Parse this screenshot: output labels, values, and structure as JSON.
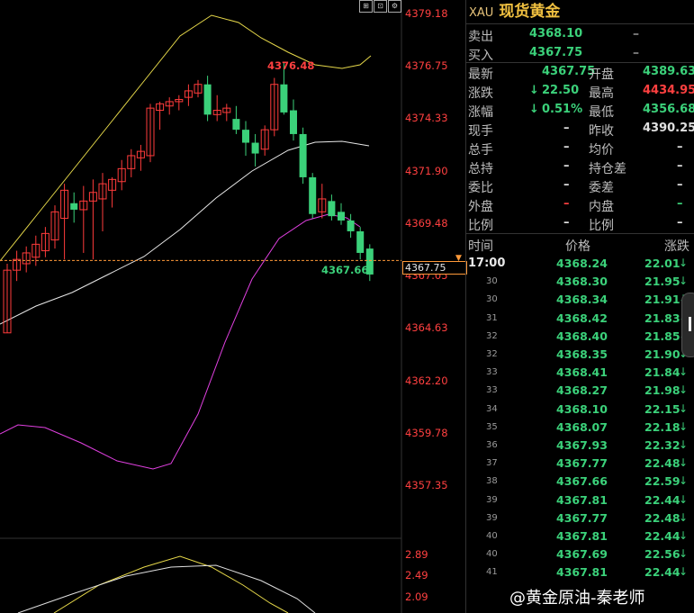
{
  "toolbar": {
    "icons": [
      "zoom-fit-icon",
      "chart-type-icon",
      "settings-icon"
    ]
  },
  "header": {
    "code": "XAU",
    "name": "现货黄金"
  },
  "quote": {
    "sell_label": "卖出",
    "sell_value": "4368.10",
    "sell_extra": "–",
    "buy_label": "买入",
    "buy_value": "4367.75",
    "buy_extra": "–",
    "rows": [
      {
        "l1": "最新",
        "v1": "4367.75",
        "l2": "开盘",
        "v2": "4389.63",
        "c1": "green",
        "c2": "green"
      },
      {
        "l1": "涨跌",
        "v1": "22.50",
        "a1": "↓",
        "l2": "最高",
        "v2": "4434.95",
        "c1": "green",
        "c2": "red"
      },
      {
        "l1": "涨幅",
        "v1": "0.51%",
        "a1": "↓",
        "l2": "最低",
        "v2": "4356.68",
        "c1": "green",
        "c2": "green"
      },
      {
        "l1": "现手",
        "v1": "–",
        "l2": "昨收",
        "v2": "4390.25",
        "c1": "white",
        "c2": "white"
      },
      {
        "l1": "总手",
        "v1": "–",
        "l2": "均价",
        "v2": "–",
        "c1": "white",
        "c2": "white"
      },
      {
        "l1": "总持",
        "v1": "–",
        "l2": "持仓差",
        "v2": "–",
        "c1": "white",
        "c2": "white"
      },
      {
        "l1": "委比",
        "v1": "–",
        "l2": "委差",
        "v2": "–",
        "c1": "white",
        "c2": "white"
      },
      {
        "l1": "外盘",
        "v1": "–",
        "l2": "内盘",
        "v2": "–",
        "c1": "red",
        "c2": "green"
      },
      {
        "l1": "比例",
        "v1": "–",
        "l2": "比例",
        "v2": "–",
        "c1": "white",
        "c2": "white"
      }
    ]
  },
  "ticks_header": {
    "time": "时间",
    "price": "价格",
    "change": "涨跌"
  },
  "ticks": [
    {
      "t": "17:00",
      "p": "4368.24",
      "c": "22.01"
    },
    {
      "t": "30",
      "p": "4368.30",
      "c": "21.95"
    },
    {
      "t": "30",
      "p": "4368.34",
      "c": "21.91"
    },
    {
      "t": "31",
      "p": "4368.42",
      "c": "21.83"
    },
    {
      "t": "32",
      "p": "4368.40",
      "c": "21.85"
    },
    {
      "t": "32",
      "p": "4368.35",
      "c": "21.90"
    },
    {
      "t": "33",
      "p": "4368.41",
      "c": "21.84"
    },
    {
      "t": "33",
      "p": "4368.27",
      "c": "21.98"
    },
    {
      "t": "34",
      "p": "4368.10",
      "c": "22.15"
    },
    {
      "t": "35",
      "p": "4368.07",
      "c": "22.18"
    },
    {
      "t": "36",
      "p": "4367.93",
      "c": "22.32"
    },
    {
      "t": "37",
      "p": "4367.77",
      "c": "22.48"
    },
    {
      "t": "38",
      "p": "4367.66",
      "c": "22.59"
    },
    {
      "t": "39",
      "p": "4367.81",
      "c": "22.44"
    },
    {
      "t": "39",
      "p": "4367.77",
      "c": "22.48"
    },
    {
      "t": "40",
      "p": "4367.81",
      "c": "22.44"
    },
    {
      "t": "40",
      "p": "4367.69",
      "c": "22.56"
    },
    {
      "t": "41",
      "p": "4367.81",
      "c": "22.44"
    }
  ],
  "watermark": "@黄金原油-秦老师",
  "chart_data": {
    "type": "candlestick",
    "y_axis_labels": [
      "4379.18",
      "4376.75",
      "4374.33",
      "4371.90",
      "4369.48",
      "4367.05",
      "4364.63",
      "4362.20",
      "4359.78",
      "4357.35"
    ],
    "ylim": [
      4356.0,
      4380.0
    ],
    "last_price_tag": "4367.75",
    "high_annotation": "4376.48",
    "low_annotation": "4367.66",
    "indicator_labels": [
      "2.89",
      "2.49",
      "2.09"
    ],
    "colors": {
      "up": "#ff3b3b",
      "down": "#3bd17a",
      "upper_band": "#e6d84a",
      "mid_band": "#e8e8e8",
      "lower_band": "#e040e0",
      "axis": "#ff4040"
    },
    "candles": [
      {
        "o": 4364.4,
        "h": 4367.6,
        "l": 4364.4,
        "c": 4367.3
      },
      {
        "o": 4367.3,
        "h": 4368.2,
        "l": 4366.8,
        "c": 4367.8
      },
      {
        "o": 4367.6,
        "h": 4368.4,
        "l": 4367.2,
        "c": 4368.1
      },
      {
        "o": 4367.9,
        "h": 4368.9,
        "l": 4367.5,
        "c": 4368.5
      },
      {
        "o": 4368.2,
        "h": 4369.3,
        "l": 4367.9,
        "c": 4369.0
      },
      {
        "o": 4368.7,
        "h": 4370.3,
        "l": 4368.3,
        "c": 4370.0
      },
      {
        "o": 4369.7,
        "h": 4371.3,
        "l": 4367.8,
        "c": 4371.0
      },
      {
        "o": 4370.4,
        "h": 4370.9,
        "l": 4369.5,
        "c": 4370.1
      },
      {
        "o": 4370.1,
        "h": 4371.2,
        "l": 4368.1,
        "c": 4370.5
      },
      {
        "o": 4370.5,
        "h": 4371.5,
        "l": 4367.8,
        "c": 4370.9
      },
      {
        "o": 4370.6,
        "h": 4371.8,
        "l": 4369.1,
        "c": 4371.3
      },
      {
        "o": 4371.0,
        "h": 4371.6,
        "l": 4370.2,
        "c": 4371.5
      },
      {
        "o": 4371.4,
        "h": 4372.4,
        "l": 4371.0,
        "c": 4372.0
      },
      {
        "o": 4372.0,
        "h": 4372.9,
        "l": 4371.6,
        "c": 4372.6
      },
      {
        "o": 4372.5,
        "h": 4373.1,
        "l": 4371.9,
        "c": 4372.8
      },
      {
        "o": 4372.6,
        "h": 4375.0,
        "l": 4372.3,
        "c": 4374.8
      },
      {
        "o": 4374.7,
        "h": 4375.1,
        "l": 4373.8,
        "c": 4375.0
      },
      {
        "o": 4374.9,
        "h": 4375.3,
        "l": 4374.5,
        "c": 4375.1
      },
      {
        "o": 4375.1,
        "h": 4375.4,
        "l": 4374.7,
        "c": 4375.2
      },
      {
        "o": 4375.3,
        "h": 4375.9,
        "l": 4374.9,
        "c": 4375.6
      },
      {
        "o": 4375.5,
        "h": 4376.1,
        "l": 4375.3,
        "c": 4375.9
      },
      {
        "o": 4375.9,
        "h": 4376.3,
        "l": 4374.2,
        "c": 4374.5
      },
      {
        "o": 4374.5,
        "h": 4375.4,
        "l": 4374.2,
        "c": 4374.7
      },
      {
        "o": 4374.6,
        "h": 4375.0,
        "l": 4374.2,
        "c": 4374.8
      },
      {
        "o": 4374.3,
        "h": 4374.9,
        "l": 4373.6,
        "c": 4373.8
      },
      {
        "o": 4373.8,
        "h": 4374.2,
        "l": 4372.6,
        "c": 4373.2
      },
      {
        "o": 4373.2,
        "h": 4373.6,
        "l": 4372.1,
        "c": 4372.7
      },
      {
        "o": 4372.9,
        "h": 4374.0,
        "l": 4372.6,
        "c": 4373.8
      },
      {
        "o": 4373.8,
        "h": 4376.2,
        "l": 4373.5,
        "c": 4375.9
      },
      {
        "o": 4375.9,
        "h": 4376.9,
        "l": 4374.5,
        "c": 4374.6
      },
      {
        "o": 4374.7,
        "h": 4375.2,
        "l": 4373.3,
        "c": 4373.6
      },
      {
        "o": 4373.6,
        "h": 4373.9,
        "l": 4371.3,
        "c": 4371.6
      },
      {
        "o": 4371.6,
        "h": 4371.8,
        "l": 4369.7,
        "c": 4369.9
      },
      {
        "o": 4370.0,
        "h": 4371.3,
        "l": 4369.7,
        "c": 4370.6
      },
      {
        "o": 4370.5,
        "h": 4370.8,
        "l": 4369.6,
        "c": 4369.8
      },
      {
        "o": 4370.0,
        "h": 4370.4,
        "l": 4369.4,
        "c": 4369.6
      },
      {
        "o": 4369.6,
        "h": 4369.9,
        "l": 4368.8,
        "c": 4369.1
      },
      {
        "o": 4369.1,
        "h": 4369.3,
        "l": 4367.8,
        "c": 4368.1
      },
      {
        "o": 4368.3,
        "h": 4368.5,
        "l": 4366.8,
        "c": 4367.1
      }
    ]
  }
}
